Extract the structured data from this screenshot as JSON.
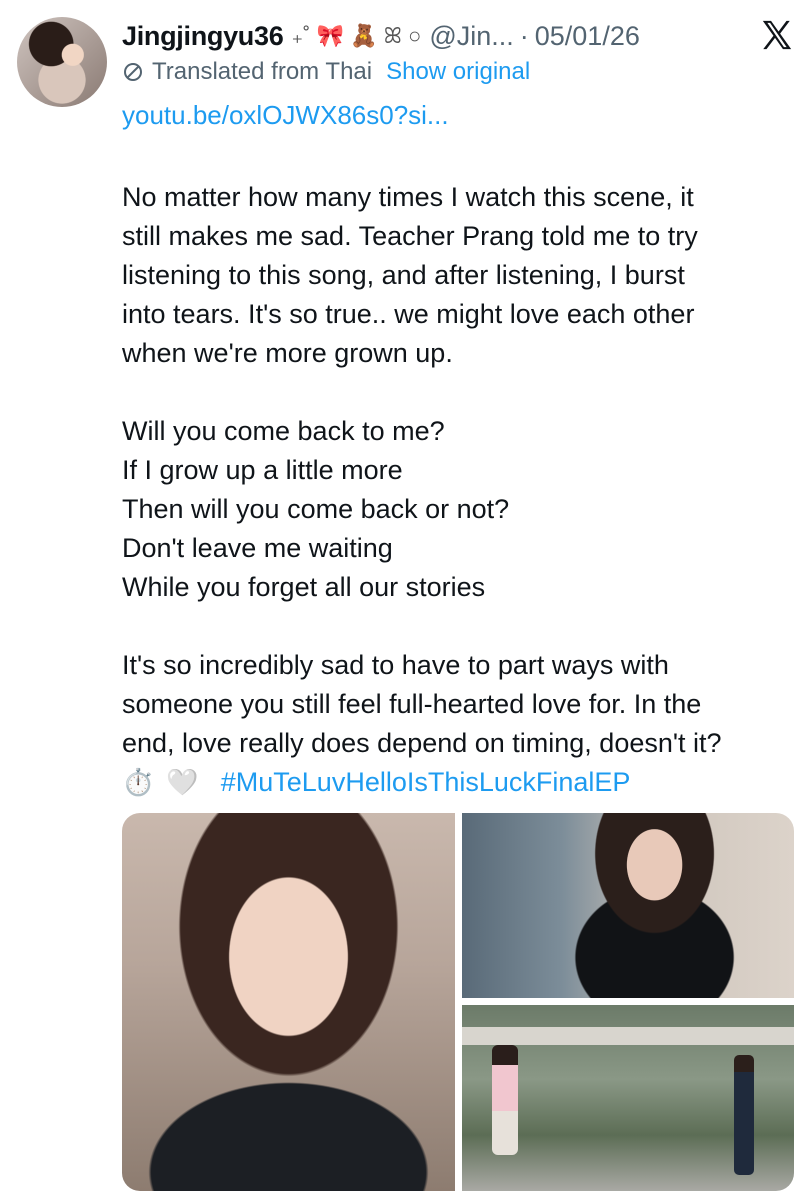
{
  "tweet": {
    "display_name": "Jingjingyu36",
    "name_decor": "₊˚",
    "name_emojis": [
      "🎀",
      "🧸",
      "ꕤ",
      "○"
    ],
    "handle": "@Jin...",
    "separator": "·",
    "date": "05/01/26",
    "translation_note": "Translated from Thai",
    "show_original": "Show original",
    "link": "youtu.be/oxlOJWX86s0?si...",
    "paragraphs": [
      [
        "No matter how many times I watch this scene, it",
        "still makes me sad. Teacher Prang told me to try",
        "listening to this song, and after listening, I burst",
        "into tears. It's so true.. we might love each other",
        "when we're more grown up."
      ],
      [
        "Will you come back to me?",
        "If I grow up a little more",
        "Then will you come back or not?",
        "Don't leave me waiting",
        "While you forget all our stories"
      ],
      [
        "It's so incredibly sad to have to part ways with",
        "someone you still feel full-hearted love for. In the",
        "end, love really does depend on timing, doesn't it?"
      ]
    ],
    "closing_emojis": [
      "⏱️",
      "🤍"
    ],
    "hashtag": "#MuTeLuvHelloIsThisLuckFinalEP"
  },
  "colors": {
    "link": "#1d9bf0",
    "secondary_text": "#536471",
    "primary_text": "#0f1419"
  },
  "icons": {
    "platform": "x-logo-icon",
    "translate": "ban-icon"
  }
}
